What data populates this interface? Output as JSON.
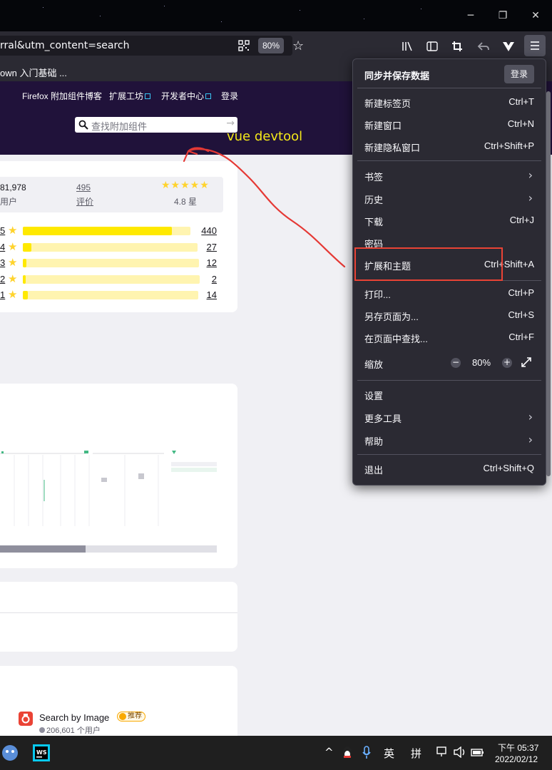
{
  "browser": {
    "url_visible": "rral&utm_content=search",
    "zoom": "80%",
    "bookmark": "own 入门基础 ..."
  },
  "amo": {
    "nav": [
      "Firefox 附加组件博客",
      "扩展工坊",
      "开发者中心",
      "登录"
    ],
    "search_placeholder": "查找附加组件",
    "stats": {
      "users": "81,978",
      "users_label": "用户",
      "reviews": "495",
      "reviews_label": "评价",
      "rating": "4.8 星",
      "rating_stars": 5
    },
    "ratings": [
      {
        "stars": "5",
        "count": "440",
        "fraction": 0.89
      },
      {
        "stars": "4",
        "count": "27",
        "fraction": 0.05
      },
      {
        "stars": "3",
        "count": "12",
        "fraction": 0.02
      },
      {
        "stars": "2",
        "count": "2",
        "fraction": 0.005
      },
      {
        "stars": "1",
        "count": "14",
        "fraction": 0.03
      }
    ],
    "recommended": {
      "name": "Search by Image",
      "badge": "推荐",
      "users": "206,601 个用户"
    }
  },
  "annotation": {
    "text": "vue devtool",
    "color": "#f4e81a",
    "arrow_color": "#e53935"
  },
  "menu": {
    "sync_label": "同步并保存数据",
    "login": "登录",
    "items": [
      {
        "label": "新建标签页",
        "shortcut": "Ctrl+T"
      },
      {
        "label": "新建窗口",
        "shortcut": "Ctrl+N"
      },
      {
        "label": "新建隐私窗口",
        "shortcut": "Ctrl+Shift+P"
      },
      {
        "label": "书签",
        "shortcut": ""
      },
      {
        "label": "历史",
        "shortcut": ""
      },
      {
        "label": "下载",
        "shortcut": "Ctrl+J"
      },
      {
        "label": "密码",
        "shortcut": ""
      },
      {
        "label": "扩展和主题",
        "shortcut": "Ctrl+Shift+A"
      },
      {
        "label": "打印...",
        "shortcut": "Ctrl+P"
      },
      {
        "label": "另存页面为...",
        "shortcut": "Ctrl+S"
      },
      {
        "label": "在页面中查找...",
        "shortcut": "Ctrl+F"
      },
      {
        "label": "缩放",
        "shortcut": ""
      },
      {
        "label": "设置",
        "shortcut": ""
      },
      {
        "label": "更多工具",
        "shortcut": ""
      },
      {
        "label": "帮助",
        "shortcut": ""
      },
      {
        "label": "退出",
        "shortcut": "Ctrl+Shift+Q"
      }
    ],
    "zoom_value": "80%",
    "zoom_minus": "−",
    "zoom_plus": "+"
  },
  "taskbar": {
    "ime_lang": "英",
    "ime_mode": "拼",
    "time": "下午 05:37",
    "date": "2022/02/12"
  }
}
